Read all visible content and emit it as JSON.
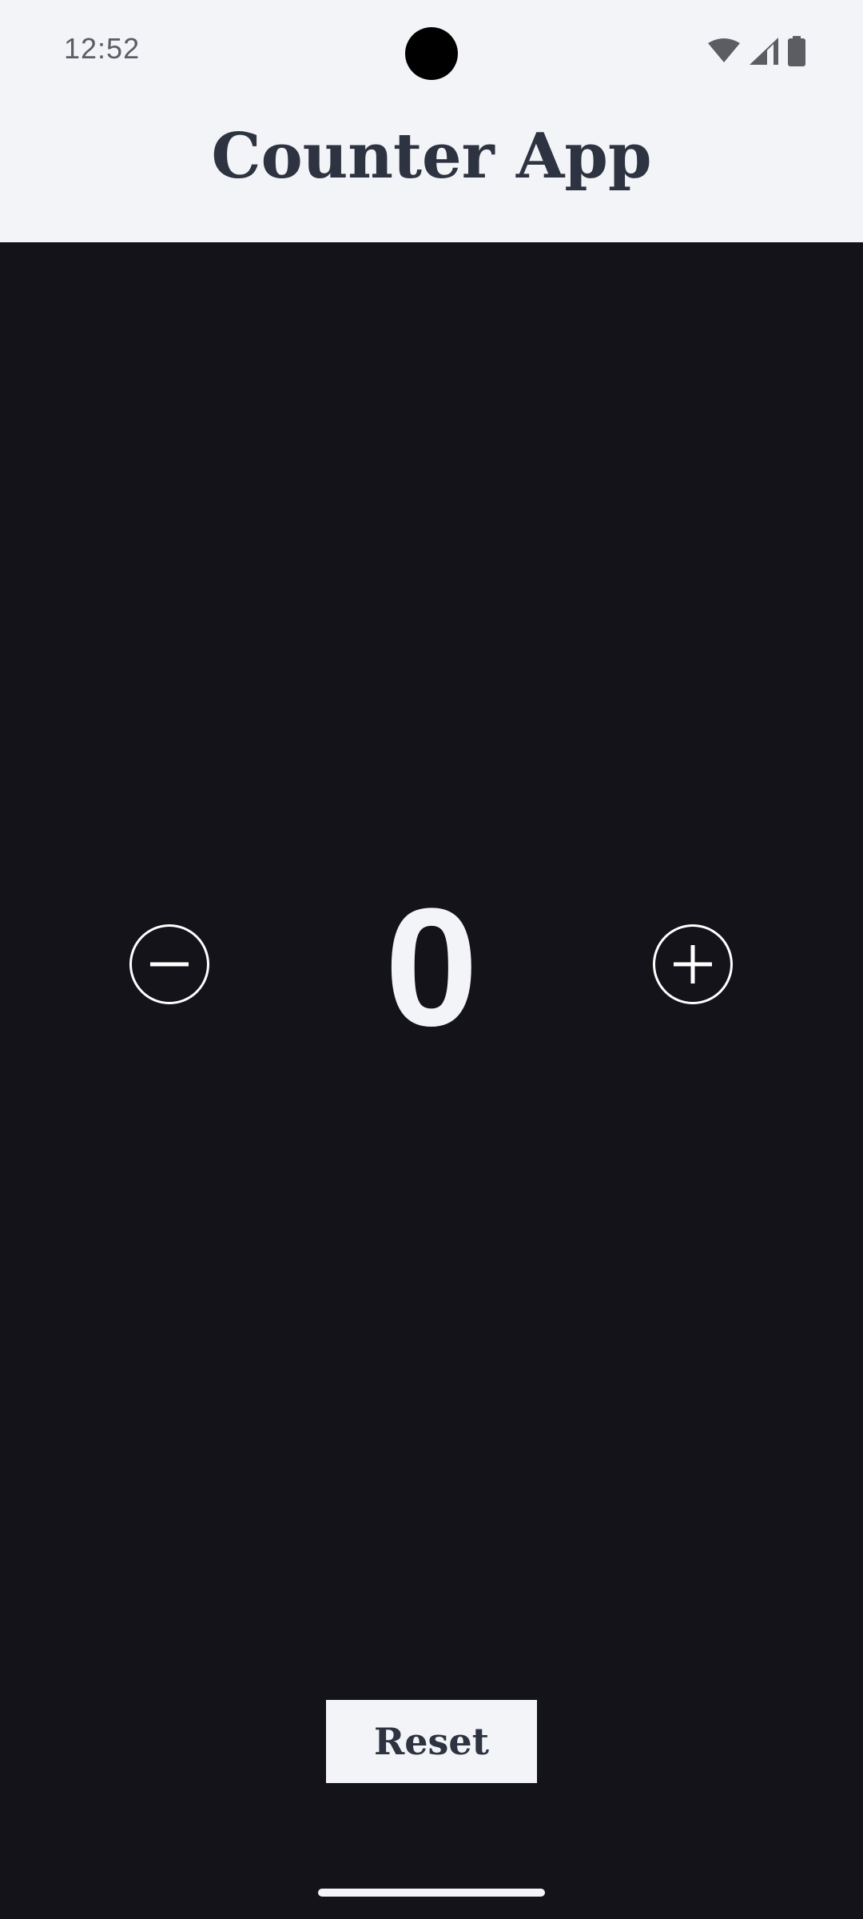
{
  "status_bar": {
    "time": "12:52",
    "icons": [
      "wifi-icon",
      "cellular-signal-icon",
      "battery-icon"
    ]
  },
  "header": {
    "title": "Counter App"
  },
  "counter": {
    "value": "0",
    "decrement_icon": "minus-circle-icon",
    "increment_icon": "plus-circle-icon"
  },
  "actions": {
    "reset_label": "Reset"
  },
  "colors": {
    "background": "#15131a",
    "surface": "#f3f4f8",
    "text_dark": "#2d3340",
    "icon_white": "#ffffff"
  }
}
